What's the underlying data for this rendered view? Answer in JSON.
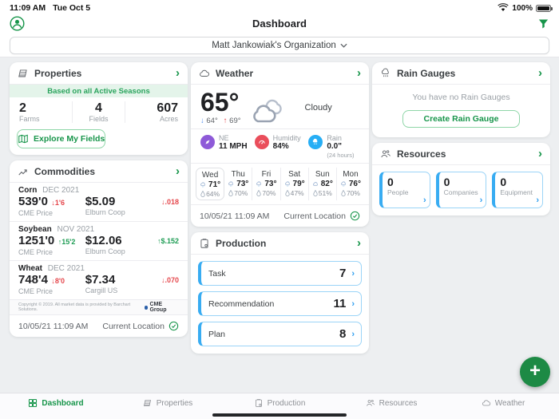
{
  "status_bar": {
    "time": "11:09 AM",
    "date": "Tue Oct 5",
    "battery": "100%"
  },
  "header": {
    "title": "Dashboard"
  },
  "org_selector": {
    "label": "Matt Jankowiak's Organization"
  },
  "properties": {
    "title": "Properties",
    "banner": "Based on all Active Seasons",
    "stats": [
      {
        "value": "2",
        "label": "Farms"
      },
      {
        "value": "4",
        "label": "Fields"
      },
      {
        "value": "607",
        "label": "Acres"
      }
    ],
    "button": "Explore My Fields"
  },
  "commodities": {
    "title": "Commodities",
    "rows": [
      {
        "name": "Corn",
        "contract": "DEC 2021",
        "price": "539'0",
        "change": "↓1'6",
        "source": "CME Price",
        "local_price": "$5.09",
        "local_source": "Elburn Coop",
        "local_change": "↓.018"
      },
      {
        "name": "Soybean",
        "contract": "NOV 2021",
        "price": "1251'0",
        "change": "↑15'2",
        "source": "CME Price",
        "local_price": "$12.06",
        "local_source": "Elburn Coop",
        "local_change": "↑$.152"
      },
      {
        "name": "Wheat",
        "contract": "DEC 2021",
        "price": "748'4",
        "change": "↓8'0",
        "source": "CME Price",
        "local_price": "$7.34",
        "local_source": "Cargill US",
        "local_change": "↓.070"
      }
    ],
    "copyright": "Copyright © 2019. All market data is provided by Barchart Solutions.",
    "attribution": "CME Group",
    "timestamp": "10/05/21 11:09 AM",
    "location_label": "Current Location"
  },
  "weather": {
    "title": "Weather",
    "current_temp": "65°",
    "low": "64°",
    "high": "69°",
    "condition": "Cloudy",
    "metrics": {
      "wind_label": "NE",
      "wind_value": "11 MPH",
      "humidity_label": "Humidity",
      "humidity_value": "84%",
      "rain_label": "Rain",
      "rain_value": "0.0\"",
      "rain_sub": "(24 hours)"
    },
    "forecast": [
      {
        "day": "Wed",
        "temp": "71°",
        "precip": "64%"
      },
      {
        "day": "Thu",
        "temp": "73°",
        "precip": "70%"
      },
      {
        "day": "Fri",
        "temp": "73°",
        "precip": "70%"
      },
      {
        "day": "Sat",
        "temp": "79°",
        "precip": "47%"
      },
      {
        "day": "Sun",
        "temp": "82°",
        "precip": "51%"
      },
      {
        "day": "Mon",
        "temp": "76°",
        "precip": "70%"
      }
    ],
    "timestamp": "10/05/21 11:09 AM",
    "location_label": "Current Location"
  },
  "rain_gauges": {
    "title": "Rain Gauges",
    "empty_message": "You have no Rain Gauges",
    "button": "Create Rain Gauge"
  },
  "resources": {
    "title": "Resources",
    "items": [
      {
        "count": "0",
        "label": "People"
      },
      {
        "count": "0",
        "label": "Companies"
      },
      {
        "count": "0",
        "label": "Equipment"
      }
    ]
  },
  "production": {
    "title": "Production",
    "items": [
      {
        "label": "Task",
        "count": "7"
      },
      {
        "label": "Recommendation",
        "count": "11"
      },
      {
        "label": "Plan",
        "count": "8"
      }
    ]
  },
  "bottom_nav": {
    "items": [
      {
        "label": "Dashboard"
      },
      {
        "label": "Properties"
      },
      {
        "label": "Production"
      },
      {
        "label": "Resources"
      },
      {
        "label": "Weather"
      }
    ]
  },
  "colors": {
    "accent_green": "#17954a",
    "blue_accent": "#38acf2",
    "down_red": "#e5484d",
    "up_green": "#1f9d55"
  }
}
